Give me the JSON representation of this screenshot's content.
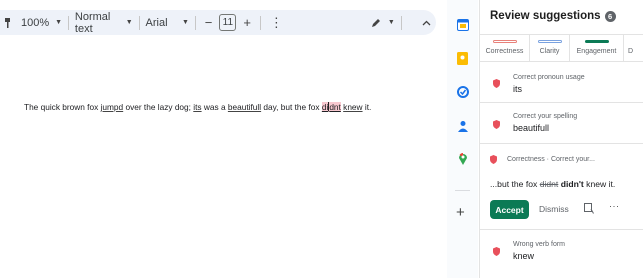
{
  "toolbar": {
    "zoom": "100%",
    "style": "Normal text",
    "font": "Arial",
    "font_size": "11",
    "minus": "−",
    "plus": "+",
    "more": "⋮",
    "collapse": "^"
  },
  "document": {
    "segments": [
      {
        "text": "The quick brown fox ",
        "error": false
      },
      {
        "text": "jumpd",
        "error": true
      },
      {
        "text": " over the lazy dog; ",
        "error": false
      },
      {
        "text": "its",
        "error": true
      },
      {
        "text": " was a ",
        "error": false
      },
      {
        "text": "beautifull",
        "error": true
      },
      {
        "text": " day, but the fox ",
        "error": false
      },
      {
        "text": "di",
        "error": "selected"
      },
      {
        "text": "dnt",
        "error": "selected"
      },
      {
        "text": " ",
        "error": false
      },
      {
        "text": "knew",
        "error": true
      },
      {
        "text": " it.",
        "error": false
      }
    ]
  },
  "panel": {
    "title": "Review suggestions",
    "count": "6",
    "tabs": [
      {
        "label": "Correctness",
        "color": "#e8817a"
      },
      {
        "label": "Clarity",
        "color": "#7aa2e0"
      },
      {
        "label": "Engagement",
        "color": "#0b7a55"
      },
      {
        "label": "D",
        "color": "#b58ad6"
      }
    ],
    "suggestions": [
      {
        "label": "Correct pronoun usage",
        "value": "its"
      },
      {
        "label": "Correct your spelling",
        "value": "beautifull"
      }
    ],
    "expanded": {
      "header": "Correctness · Correct your...",
      "prefix": "...but the fox ",
      "old": "didnt",
      "new": "didn't",
      "suffix": " knew it.",
      "accept": "Accept",
      "dismiss": "Dismiss",
      "more": "···"
    },
    "last": {
      "label": "Wrong verb form",
      "value": "knew"
    }
  },
  "colors": {
    "accent": "#0b7a55",
    "shield": "#e8505b",
    "toolbar_bg": "#eef2f9"
  }
}
